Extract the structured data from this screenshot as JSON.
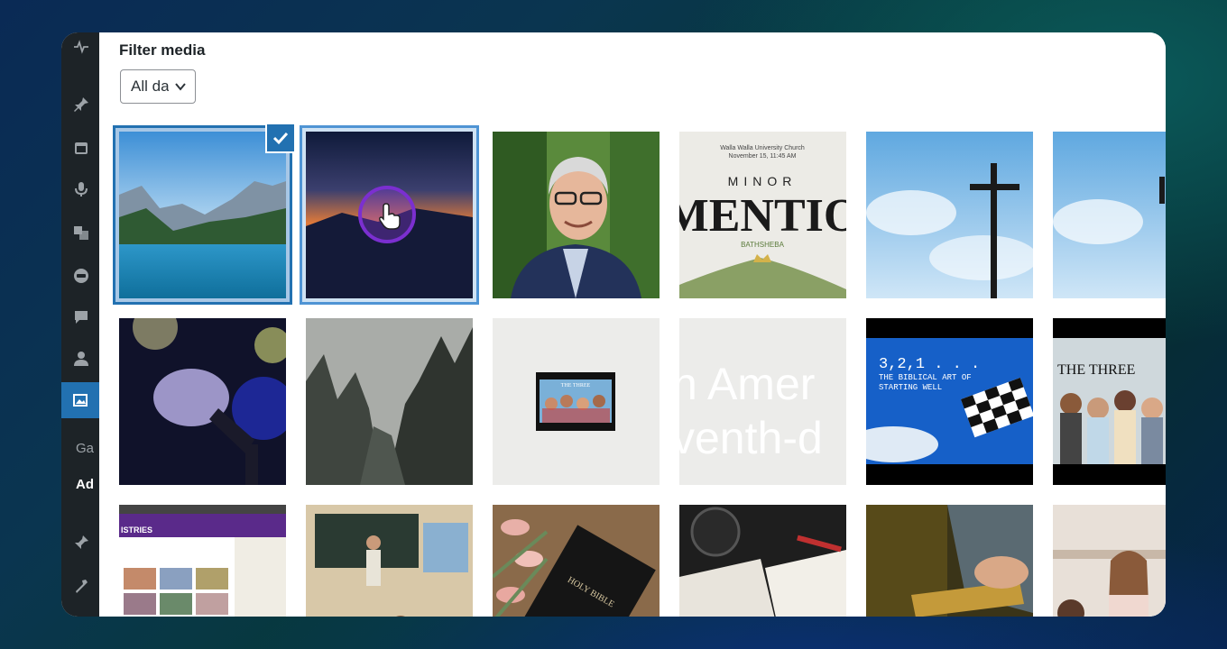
{
  "sidebar": {
    "menu_icons": [
      "wordpress-icon",
      "pin-icon",
      "calendar-icon",
      "microphone-icon",
      "media-icon",
      "comments-circle-icon",
      "comment-icon",
      "user-icon",
      "gallery-icon",
      "plugins-icon",
      "tools-icon"
    ],
    "labels": {
      "gallery_text": "Ga",
      "add_text": "Ad"
    }
  },
  "filter": {
    "title": "Filter media",
    "date_value": "All dates"
  },
  "tiles": [
    {
      "id": "lake-mountains",
      "selected": true
    },
    {
      "id": "sunset-dark-mountains",
      "selected": false,
      "hovered": true
    },
    {
      "id": "man-portrait"
    },
    {
      "id": "minor-mentions",
      "text_lines": [
        "Walla Walla University Church",
        "November 15, 11:45 AM",
        "MINOR",
        "MENTIO",
        "BATHSHEBA"
      ]
    },
    {
      "id": "cross-sky"
    },
    {
      "id": "sky-partial"
    },
    {
      "id": "microphone"
    },
    {
      "id": "foggy-cliffs"
    },
    {
      "id": "small-video-thumb",
      "text": "THE THREE"
    },
    {
      "id": "faded-text",
      "text_lines": [
        "n Amer",
        "venth-d"
      ]
    },
    {
      "id": "biblical-art",
      "text_lines": [
        "3,2,1 . . .",
        "THE BIBLICAL ART OF",
        "STARTING WELL"
      ]
    },
    {
      "id": "the-three-group",
      "text": "THE THREE"
    },
    {
      "id": "ministries-site",
      "text": "ISTRIES"
    },
    {
      "id": "classroom"
    },
    {
      "id": "holy-bible-tulips",
      "text": "HOLY BIBLE"
    },
    {
      "id": "coffee-bible"
    },
    {
      "id": "hands-bible"
    },
    {
      "id": "girl-kitchen"
    }
  ],
  "colors": {
    "accent": "#2271b1",
    "admin_bg": "#1d2327",
    "cursor": "#7b2fd0"
  }
}
